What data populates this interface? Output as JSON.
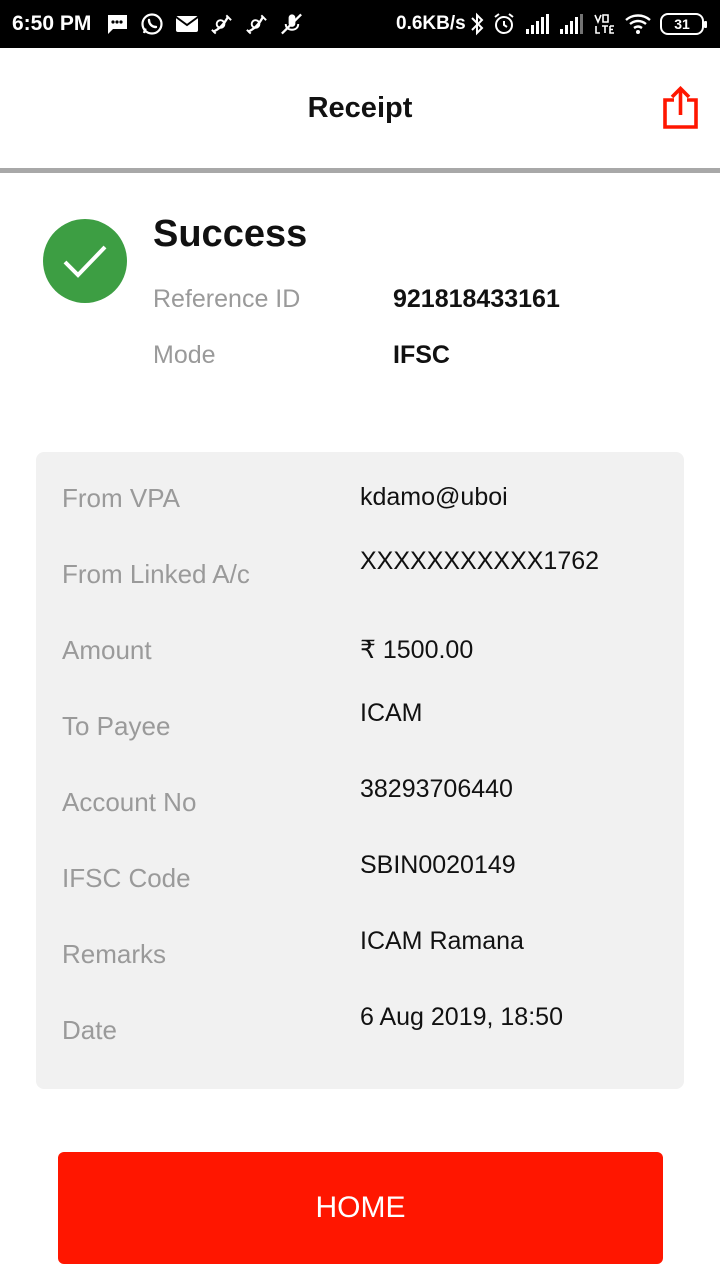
{
  "status_bar": {
    "time": "6:50 PM",
    "network_speed": "0.6KB/s",
    "battery_level": "31",
    "left_icons": [
      "message-icon",
      "whatsapp-icon",
      "mail-icon",
      "satellite-icon",
      "satellite-icon",
      "mic-off-icon"
    ],
    "right_icons": [
      "bluetooth-icon",
      "alarm-icon",
      "signal-icon",
      "signal-icon",
      "volte-icon",
      "wifi-icon",
      "battery-icon"
    ]
  },
  "header": {
    "title": "Receipt",
    "share_icon": "share-icon",
    "accent_color": "#ff1600"
  },
  "summary": {
    "status": "Success",
    "status_color": "#3d9e43",
    "reference_label": "Reference ID",
    "reference_value": "921818433161",
    "mode_label": "Mode",
    "mode_value": "IFSC"
  },
  "details": [
    {
      "label": "From VPA",
      "value": "kdamo@uboi"
    },
    {
      "label": "From Linked A/c",
      "value": "XXXXXXXXXXX1762"
    },
    {
      "label": "Amount",
      "value": "₹ 1500.00"
    },
    {
      "label": "To Payee",
      "value": "ICAM"
    },
    {
      "label": "Account No",
      "value": "38293706440"
    },
    {
      "label": "IFSC Code",
      "value": "SBIN0020149"
    },
    {
      "label": "Remarks",
      "value": "ICAM Ramana"
    },
    {
      "label": "Date",
      "value": "6 Aug 2019, 18:50"
    }
  ],
  "home_button": {
    "label": "HOME"
  }
}
